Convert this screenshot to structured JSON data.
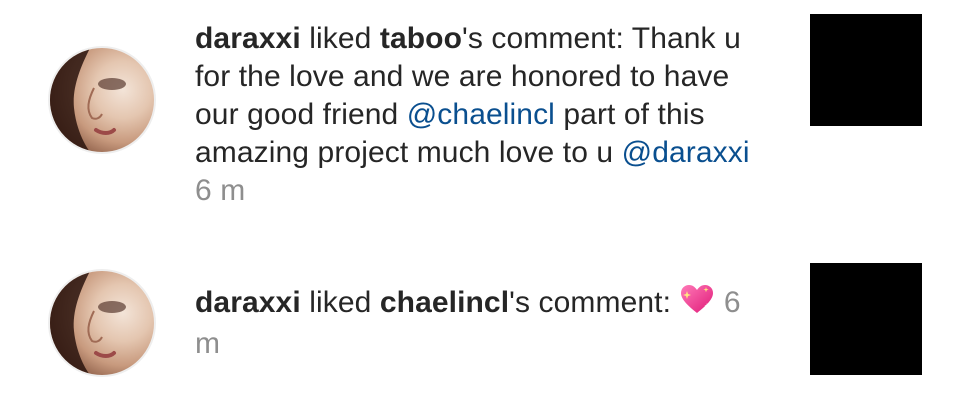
{
  "notifications": [
    {
      "actor": "daraxxi",
      "action": "liked",
      "target": "taboo",
      "possessive_suffix": "'s comment: ",
      "comment_part1": "Thank u for the love and we are honored to have our good friend ",
      "mention1": "@chaelincl",
      "comment_part2": " part of this amazing project much love to u ",
      "mention2": "@daraxxi",
      "time": "6 m"
    },
    {
      "actor": "daraxxi",
      "action": "liked",
      "target": "chaelincl",
      "possessive_suffix": "'s comment: ",
      "emoji": "sparkling-heart",
      "time": "6 m"
    }
  ],
  "colors": {
    "mention": "#0a4f8f",
    "time": "#8e8e8e",
    "text": "#262626",
    "thumbnail": "#000000"
  }
}
